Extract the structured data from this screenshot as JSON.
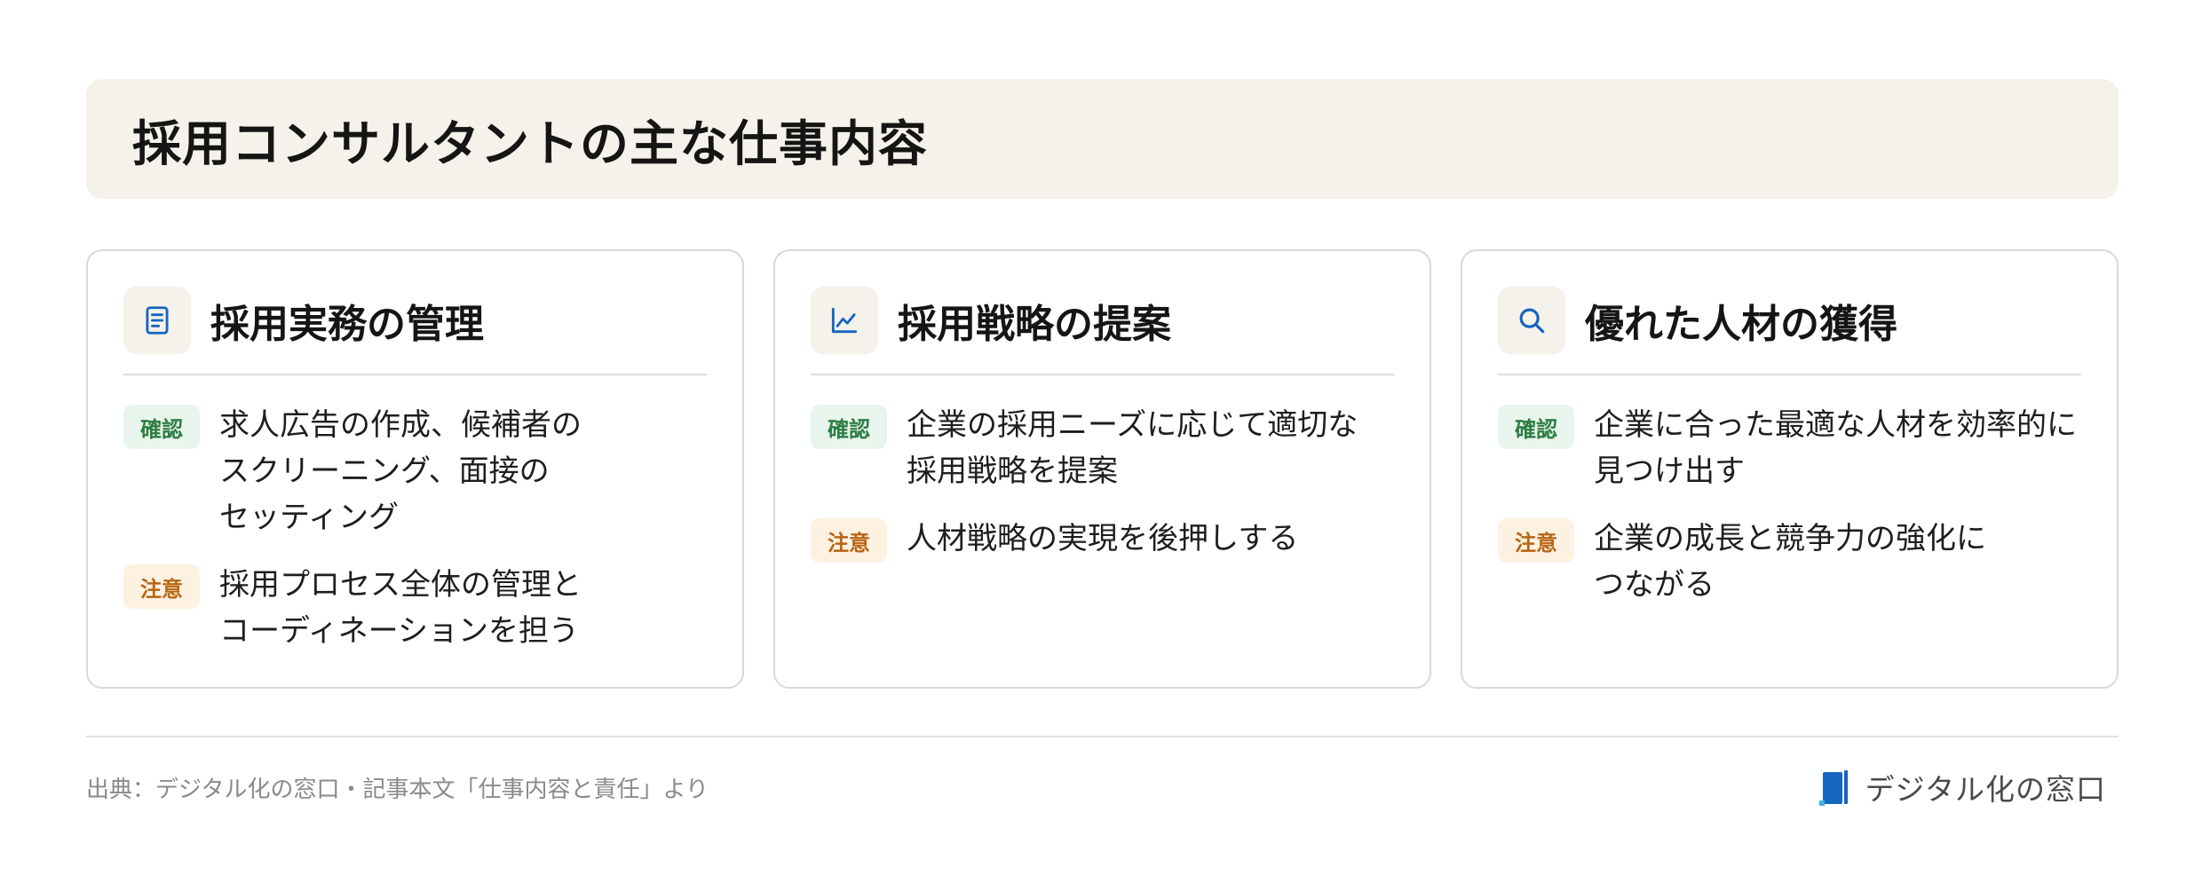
{
  "header": {
    "title": "採用コンサルタントの主な仕事内容"
  },
  "cards": [
    {
      "icon": "document-icon",
      "title": "採用実務の管理",
      "items": [
        {
          "badge": "確認",
          "text_lines": [
            "求人広告の作成、候補者の",
            "スクリーニング、面接の",
            "セッティング"
          ]
        },
        {
          "badge": "注意",
          "text_lines": [
            "採用プロセス全体の管理と",
            "コーディネーションを担う"
          ]
        }
      ]
    },
    {
      "icon": "line-chart-icon",
      "title": "採用戦略の提案",
      "items": [
        {
          "badge": "確認",
          "text_lines": [
            "企業の採用ニーズに応じて適切な",
            "採用戦略を提案"
          ]
        },
        {
          "badge": "注意",
          "text_lines": [
            "人材戦略の実現を後押しする"
          ]
        }
      ]
    },
    {
      "icon": "search-icon",
      "title": "優れた人材の獲得",
      "items": [
        {
          "badge": "確認",
          "text_lines": [
            "企業に合った最適な人材を効率的に",
            "見つけ出す"
          ]
        },
        {
          "badge": "注意",
          "text_lines": [
            "企業の成長と競争力の強化に",
            "つながる"
          ]
        }
      ]
    }
  ],
  "footer": {
    "source": "出典：デジタル化の窓口・記事本文「仕事内容と責任」より",
    "brand_name": "デジタル化の窓口"
  },
  "colors": {
    "icon_blue": "#1565c0",
    "badge_ok_text": "#2e7d43",
    "badge_ok_bg": "#e8f5ec",
    "badge_warn_text": "#b86514",
    "badge_warn_bg": "#fdf1e2",
    "banner_bg": "#f5f2eb"
  }
}
